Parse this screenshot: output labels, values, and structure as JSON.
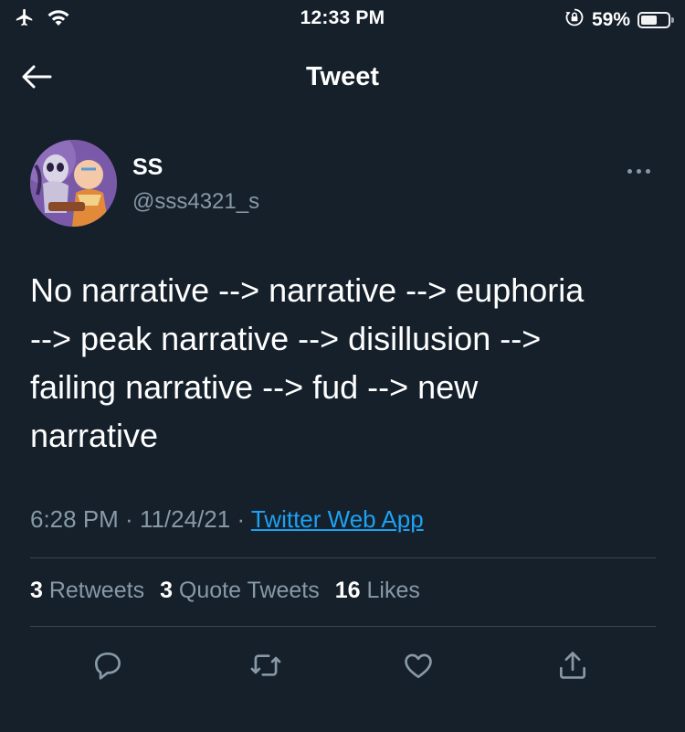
{
  "status_bar": {
    "time": "12:33 PM",
    "battery_text": "59%",
    "battery_level": 0.59,
    "icons": [
      "airplane-icon",
      "wifi-icon",
      "orientation-lock-icon",
      "battery-icon"
    ]
  },
  "nav": {
    "title": "Tweet",
    "back_icon": "back-arrow-icon"
  },
  "author": {
    "display_name": "SS",
    "username": "@sss4321_s",
    "more_icon": "more-icon"
  },
  "tweet": {
    "text": "No narrative --> narrative --> euphoria\n--> peak narrative --> disillusion -->\nfailing narrative --> fud --> new\nnarrative",
    "time": "6:28 PM",
    "separator": " · ",
    "date": "11/24/21",
    "source": "Twitter Web App"
  },
  "stats": {
    "retweets_count": "3",
    "retweets_label": " Retweets",
    "quotes_count": "3",
    "quotes_label": " Quote Tweets",
    "likes_count": "16",
    "likes_label": " Likes"
  },
  "actions": [
    "reply-icon",
    "retweet-icon",
    "like-icon",
    "share-icon"
  ],
  "colors": {
    "background": "#15202b",
    "text": "#ffffff",
    "secondary_text": "#8899a6",
    "link": "#1da1f2",
    "divider": "#38444d"
  }
}
